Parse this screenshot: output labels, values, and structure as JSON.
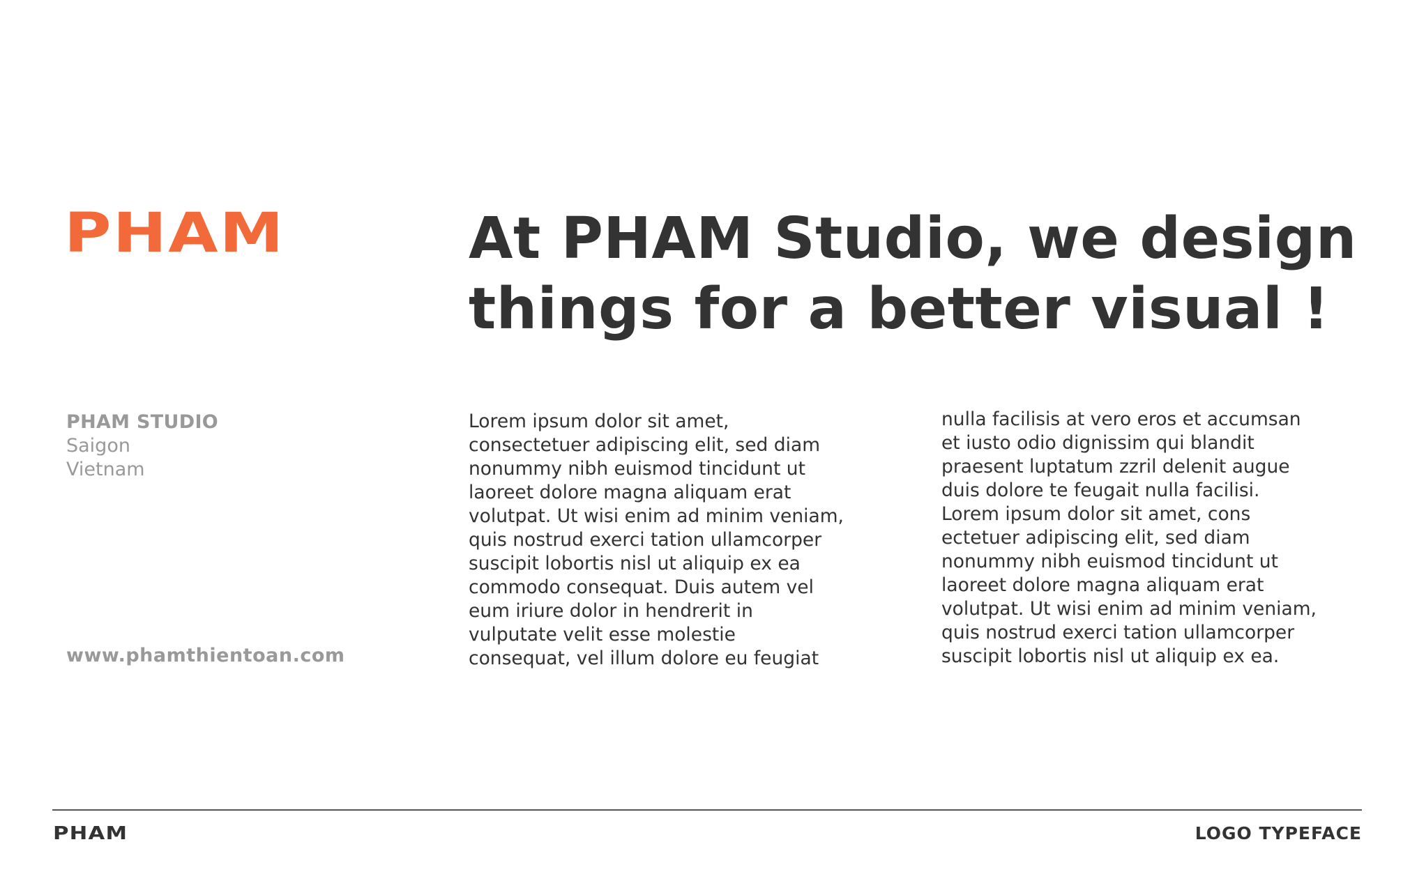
{
  "brand": {
    "wordmark": "PHAM",
    "accent_color": "#f26a3a",
    "text_color": "#333333",
    "muted_color": "#999999"
  },
  "headline": {
    "line_1": "At PHAM Studio, we design",
    "line_2": "things for a better visual !"
  },
  "studio": {
    "name": "PHAM STUDIO",
    "city": "Saigon",
    "country": "Vietnam",
    "website": "www.phamthientoan.com"
  },
  "body": {
    "column_1": "Lorem ipsum dolor sit amet,\nconsectetuer adipiscing elit, sed diam\nnonummy nibh euismod tincidunt ut\nlaoreet dolore magna aliquam erat\nvolutpat. Ut wisi enim ad minim veniam,\nquis nostrud exerci tation ullamcorper\nsuscipit lobortis nisl ut aliquip ex ea\ncommodo consequat. Duis autem vel\neum iriure dolor in hendrerit in\nvulputate velit esse molestie\nconsequat, vel illum dolore eu feugiat",
    "column_2": "nulla facilisis at vero eros et accumsan\net iusto odio dignissim qui blandit\npraesent luptatum zzril delenit augue\nduis dolore te feugait nulla facilisi.\nLorem ipsum dolor sit amet, cons\nectetuer adipiscing elit, sed diam\nnonummy nibh euismod tincidunt ut\nlaoreet dolore magna aliquam erat\nvolutpat. Ut wisi enim ad minim veniam,\nquis nostrud exerci tation ullamcorper\nsuscipit lobortis nisl ut aliquip ex ea."
  },
  "footer": {
    "brand": "PHAM",
    "label": "LOGO TYPEFACE"
  }
}
